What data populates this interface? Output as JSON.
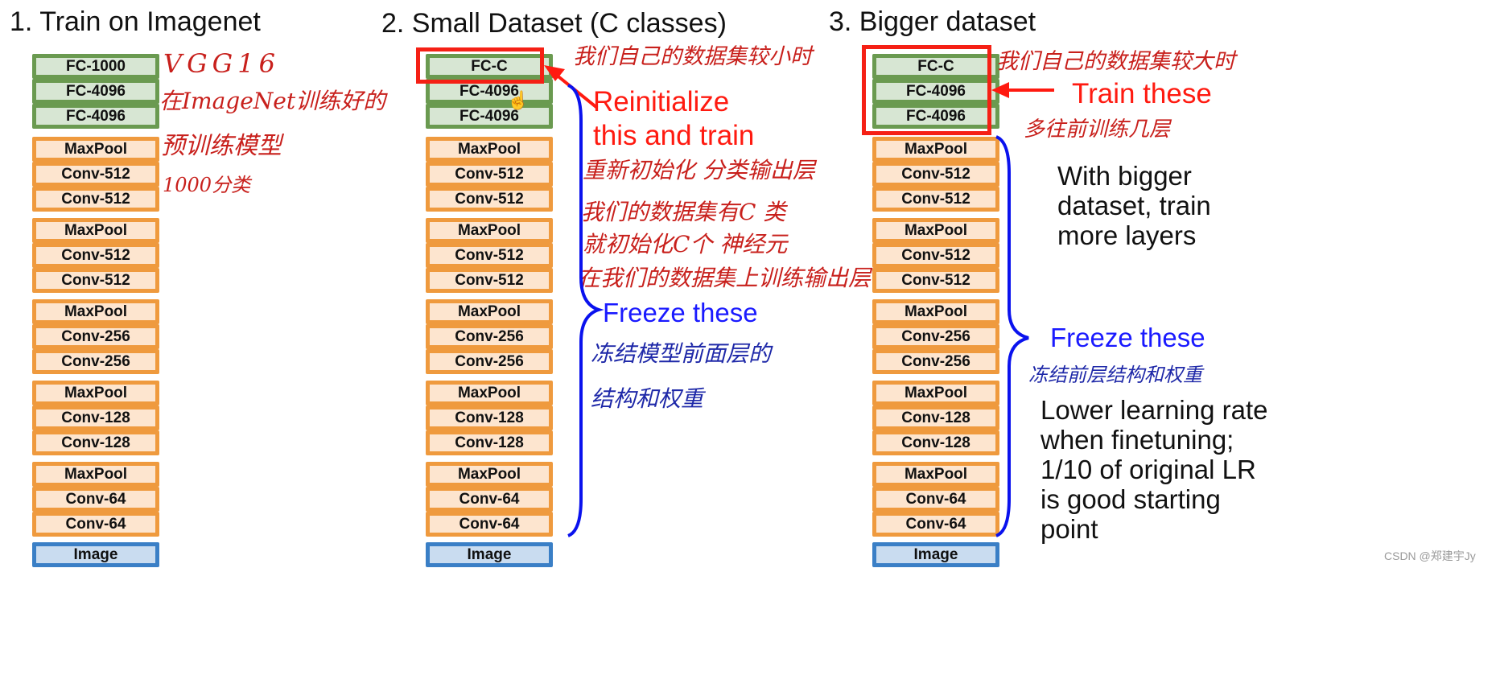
{
  "panels": [
    {
      "title": "1. Train on Imagenet",
      "layers": [
        {
          "label": "FC-1000",
          "type": "fc"
        },
        {
          "label": "FC-4096",
          "type": "fc"
        },
        {
          "label": "FC-4096",
          "type": "fc"
        },
        {
          "label": "MaxPool",
          "type": "conv"
        },
        {
          "label": "Conv-512",
          "type": "conv"
        },
        {
          "label": "Conv-512",
          "type": "conv"
        },
        {
          "label": "MaxPool",
          "type": "conv"
        },
        {
          "label": "Conv-512",
          "type": "conv"
        },
        {
          "label": "Conv-512",
          "type": "conv"
        },
        {
          "label": "MaxPool",
          "type": "conv"
        },
        {
          "label": "Conv-256",
          "type": "conv"
        },
        {
          "label": "Conv-256",
          "type": "conv"
        },
        {
          "label": "MaxPool",
          "type": "conv"
        },
        {
          "label": "Conv-128",
          "type": "conv"
        },
        {
          "label": "Conv-128",
          "type": "conv"
        },
        {
          "label": "MaxPool",
          "type": "conv"
        },
        {
          "label": "Conv-64",
          "type": "conv"
        },
        {
          "label": "Conv-64",
          "type": "conv"
        },
        {
          "label": "Image",
          "type": "img"
        }
      ],
      "notes": {
        "model_name": "VGG16",
        "pretrained_line1": "在ImageNet训练好的",
        "pretrained_line2": "预训练模型",
        "classes": "1000分类"
      }
    },
    {
      "title": "2. Small Dataset (C classes)",
      "layers": [
        {
          "label": "FC-C",
          "type": "fc"
        },
        {
          "label": "FC-4096",
          "type": "fc"
        },
        {
          "label": "FC-4096",
          "type": "fc"
        },
        {
          "label": "MaxPool",
          "type": "conv"
        },
        {
          "label": "Conv-512",
          "type": "conv"
        },
        {
          "label": "Conv-512",
          "type": "conv"
        },
        {
          "label": "MaxPool",
          "type": "conv"
        },
        {
          "label": "Conv-512",
          "type": "conv"
        },
        {
          "label": "Conv-512",
          "type": "conv"
        },
        {
          "label": "MaxPool",
          "type": "conv"
        },
        {
          "label": "Conv-256",
          "type": "conv"
        },
        {
          "label": "Conv-256",
          "type": "conv"
        },
        {
          "label": "MaxPool",
          "type": "conv"
        },
        {
          "label": "Conv-128",
          "type": "conv"
        },
        {
          "label": "Conv-128",
          "type": "conv"
        },
        {
          "label": "MaxPool",
          "type": "conv"
        },
        {
          "label": "Conv-64",
          "type": "conv"
        },
        {
          "label": "Conv-64",
          "type": "conv"
        },
        {
          "label": "Image",
          "type": "img"
        }
      ],
      "train_label_line1": "Reinitialize",
      "train_label_line2": "this and train",
      "freeze_label": "Freeze these",
      "notes": {
        "small_dataset": "我们自己的数据集较小时",
        "reinit_line1": "重新初始化 分类输出层",
        "reinit_line2": "我们的数据集有C 类",
        "reinit_line3": "就初始化C个 神经元",
        "reinit_line4": "在我们的数据集上训练输出层",
        "freeze_line1": "冻结模型前面层的",
        "freeze_line2": "结构和权重"
      }
    },
    {
      "title": "3. Bigger dataset",
      "layers": [
        {
          "label": "FC-C",
          "type": "fc"
        },
        {
          "label": "FC-4096",
          "type": "fc"
        },
        {
          "label": "FC-4096",
          "type": "fc"
        },
        {
          "label": "MaxPool",
          "type": "conv"
        },
        {
          "label": "Conv-512",
          "type": "conv"
        },
        {
          "label": "Conv-512",
          "type": "conv"
        },
        {
          "label": "MaxPool",
          "type": "conv"
        },
        {
          "label": "Conv-512",
          "type": "conv"
        },
        {
          "label": "Conv-512",
          "type": "conv"
        },
        {
          "label": "MaxPool",
          "type": "conv"
        },
        {
          "label": "Conv-256",
          "type": "conv"
        },
        {
          "label": "Conv-256",
          "type": "conv"
        },
        {
          "label": "MaxPool",
          "type": "conv"
        },
        {
          "label": "Conv-128",
          "type": "conv"
        },
        {
          "label": "Conv-128",
          "type": "conv"
        },
        {
          "label": "MaxPool",
          "type": "conv"
        },
        {
          "label": "Conv-64",
          "type": "conv"
        },
        {
          "label": "Conv-64",
          "type": "conv"
        },
        {
          "label": "Image",
          "type": "img"
        }
      ],
      "train_label": "Train these",
      "freeze_label": "Freeze these",
      "bigger_text": "With bigger dataset, train more layers",
      "lr_text": "Lower learning rate when finetuning; 1/10 of original LR is good starting point",
      "notes": {
        "bigger_dataset": "我们自己的数据集较大时",
        "train_more": "多往前训练几层",
        "freeze": "冻结前层结构和权重"
      }
    }
  ],
  "watermark": "CSDN @郑建宇Jy",
  "colors": {
    "fc_fill": "#d7e6d3",
    "fc_border": "#6a9a50",
    "conv_fill": "#fde5cf",
    "conv_border": "#ef9a3e",
    "image_fill": "#c9dcf0",
    "image_border": "#3a7fc6",
    "highlight_red": "#ff1a10",
    "freeze_blue": "#1a1aff"
  }
}
